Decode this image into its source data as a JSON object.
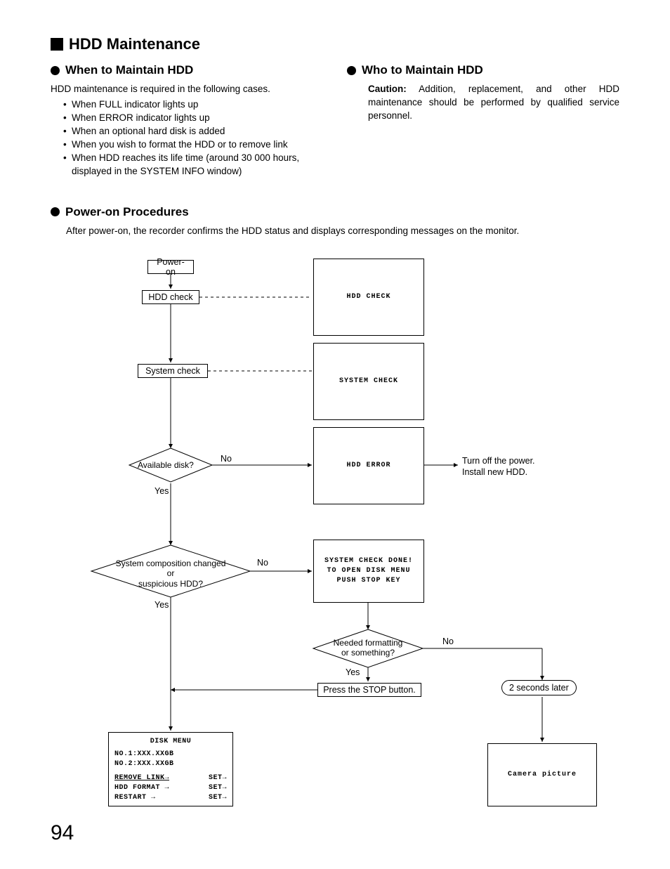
{
  "page_number": "94",
  "title": "HDD Maintenance",
  "sections": {
    "when": {
      "heading": "When to Maintain HDD",
      "intro": "HDD maintenance is required in the following cases.",
      "items": [
        "When FULL indicator lights up",
        "When ERROR indicator lights up",
        "When an optional hard disk is added",
        "When you wish to format the HDD or to remove link",
        "When HDD reaches its life time (around 30 000 hours, displayed in the SYSTEM INFO window)"
      ]
    },
    "who": {
      "heading": "Who to Maintain HDD",
      "caution_label": "Caution:",
      "caution_text": " Addition, replacement, and other HDD maintenance should be performed by qualified service personnel."
    },
    "power": {
      "heading": "Power-on Procedures",
      "intro": "After power-on, the recorder confirms the HDD status and displays corresponding messages on the monitor."
    }
  },
  "flow": {
    "power_on": "Power-on",
    "hdd_check": "HDD check",
    "system_check": "System check",
    "available_disk": "Available disk?",
    "sys_comp_l1": "System composition changed",
    "sys_comp_l2": "or",
    "sys_comp_l3": "suspicious HDD?",
    "needed_fmt_l1": "Needed formatting",
    "needed_fmt_l2": "or something?",
    "press_stop": "Press the STOP button.",
    "two_seconds": "2 seconds later",
    "yes": "Yes",
    "no": "No",
    "turn_off": "Turn off the power.\nInstall new HDD.",
    "screens": {
      "hdd_check": "HDD CHECK",
      "system_check": "SYSTEM CHECK",
      "hdd_error": "HDD ERROR",
      "done_l1": "SYSTEM CHECK DONE!",
      "done_l2": "TO OPEN DISK MENU",
      "done_l3": "PUSH STOP KEY",
      "camera": "Camera picture",
      "disk_menu_title": "DISK MENU",
      "disk_menu_l1": "NO.1:XXX.XXGB",
      "disk_menu_l2": "NO.2:XXX.XXGB",
      "disk_menu_r1a": "REMOVE LINK→",
      "disk_menu_r1b": "SET→",
      "disk_menu_r2a": "HDD FORMAT →",
      "disk_menu_r2b": "SET→",
      "disk_menu_r3a": "RESTART    →",
      "disk_menu_r3b": "SET→"
    }
  }
}
